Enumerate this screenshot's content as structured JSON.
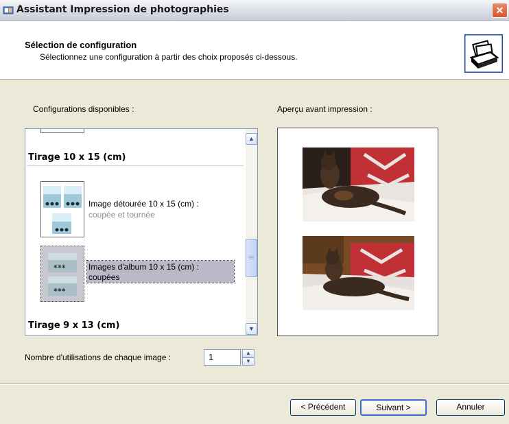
{
  "window": {
    "title": "Assistant Impression de photographies",
    "close_glyph": "✕"
  },
  "header": {
    "title": "Sélection de configuration",
    "subtitle": "Sélectionnez une configuration à partir des choix proposés ci-dessous.",
    "icon": "printer-photos-icon"
  },
  "configurations": {
    "label": "Configurations disponibles :",
    "groups": [
      {
        "header": "Tirage 10 x 15 (cm)"
      },
      {
        "header": "Tirage 9 x 13 (cm)"
      }
    ],
    "items": [
      {
        "title": "Image détourée 10 x 15 (cm) :",
        "subtitle": "coupée et tournée",
        "selected": false
      },
      {
        "title": "Images d'album 10 x 15 (cm) :",
        "subtitle": "coupées",
        "selected": true
      }
    ]
  },
  "preview": {
    "label": "Aperçu avant impression :"
  },
  "usage": {
    "label": "Nombre d'utilisations de chaque image :",
    "value": "1"
  },
  "buttons": {
    "back": "< Précédent",
    "next": "Suivant >",
    "cancel": "Annuler"
  },
  "colors": {
    "accent": "#003c74",
    "selection": "#b9b9c8",
    "close": "#d8552e"
  }
}
